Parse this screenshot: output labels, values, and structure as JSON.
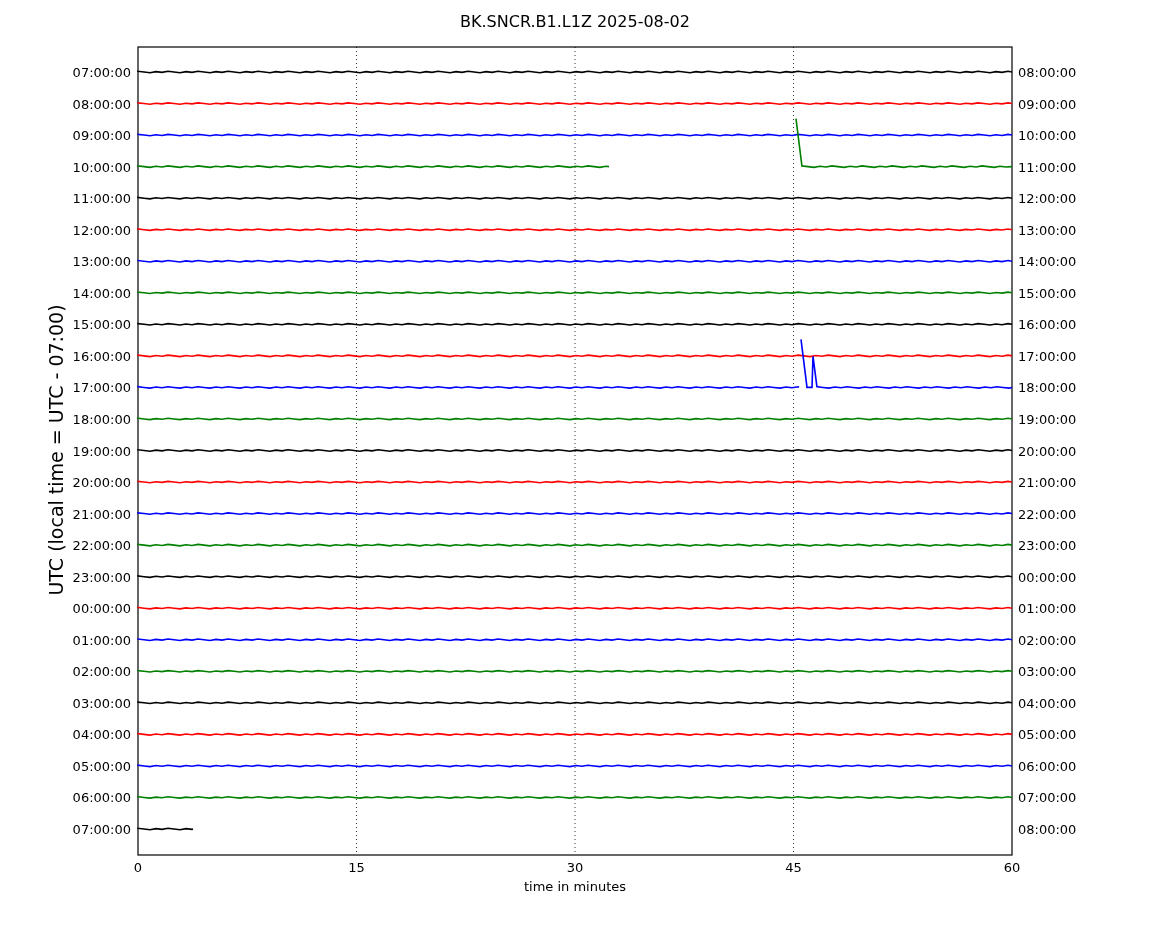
{
  "title": "BK.SNCR.B1.L1Z 2025-08-02",
  "ylabel": "UTC (local time = UTC - 07:00)",
  "xlabel": "time in minutes",
  "xticks": [
    "0",
    "15",
    "30",
    "45",
    "60"
  ],
  "rows": [
    {
      "left": "07:00:00",
      "right": "08:00:00",
      "color": "#000000",
      "kind": "flat"
    },
    {
      "left": "08:00:00",
      "right": "09:00:00",
      "color": "#ff0000",
      "kind": "flat"
    },
    {
      "left": "09:00:00",
      "right": "10:00:00",
      "color": "#0000ff",
      "kind": "flat"
    },
    {
      "left": "10:00:00",
      "right": "11:00:00",
      "color": "#008000",
      "kind": "gap"
    },
    {
      "left": "11:00:00",
      "right": "12:00:00",
      "color": "#000000",
      "kind": "flat"
    },
    {
      "left": "12:00:00",
      "right": "13:00:00",
      "color": "#ff0000",
      "kind": "flat"
    },
    {
      "left": "13:00:00",
      "right": "14:00:00",
      "color": "#0000ff",
      "kind": "flat"
    },
    {
      "left": "14:00:00",
      "right": "15:00:00",
      "color": "#008000",
      "kind": "flat"
    },
    {
      "left": "15:00:00",
      "right": "16:00:00",
      "color": "#000000",
      "kind": "flat"
    },
    {
      "left": "16:00:00",
      "right": "17:00:00",
      "color": "#ff0000",
      "kind": "flat"
    },
    {
      "left": "17:00:00",
      "right": "18:00:00",
      "color": "#0000ff",
      "kind": "spikes"
    },
    {
      "left": "18:00:00",
      "right": "19:00:00",
      "color": "#008000",
      "kind": "flat"
    },
    {
      "left": "19:00:00",
      "right": "20:00:00",
      "color": "#000000",
      "kind": "flat"
    },
    {
      "left": "20:00:00",
      "right": "21:00:00",
      "color": "#ff0000",
      "kind": "flat"
    },
    {
      "left": "21:00:00",
      "right": "22:00:00",
      "color": "#0000ff",
      "kind": "flat"
    },
    {
      "left": "22:00:00",
      "right": "23:00:00",
      "color": "#008000",
      "kind": "flat"
    },
    {
      "left": "23:00:00",
      "right": "00:00:00",
      "color": "#000000",
      "kind": "flat"
    },
    {
      "left": "00:00:00",
      "right": "01:00:00",
      "color": "#ff0000",
      "kind": "flat"
    },
    {
      "left": "01:00:00",
      "right": "02:00:00",
      "color": "#0000ff",
      "kind": "flat"
    },
    {
      "left": "02:00:00",
      "right": "03:00:00",
      "color": "#008000",
      "kind": "flat"
    },
    {
      "left": "03:00:00",
      "right": "04:00:00",
      "color": "#000000",
      "kind": "flat"
    },
    {
      "left": "04:00:00",
      "right": "05:00:00",
      "color": "#ff0000",
      "kind": "flat"
    },
    {
      "left": "05:00:00",
      "right": "06:00:00",
      "color": "#0000ff",
      "kind": "flat"
    },
    {
      "left": "06:00:00",
      "right": "07:00:00",
      "color": "#008000",
      "kind": "flat"
    },
    {
      "left": "07:00:00",
      "right": "08:00:00",
      "color": "#000000",
      "kind": "short"
    }
  ]
}
